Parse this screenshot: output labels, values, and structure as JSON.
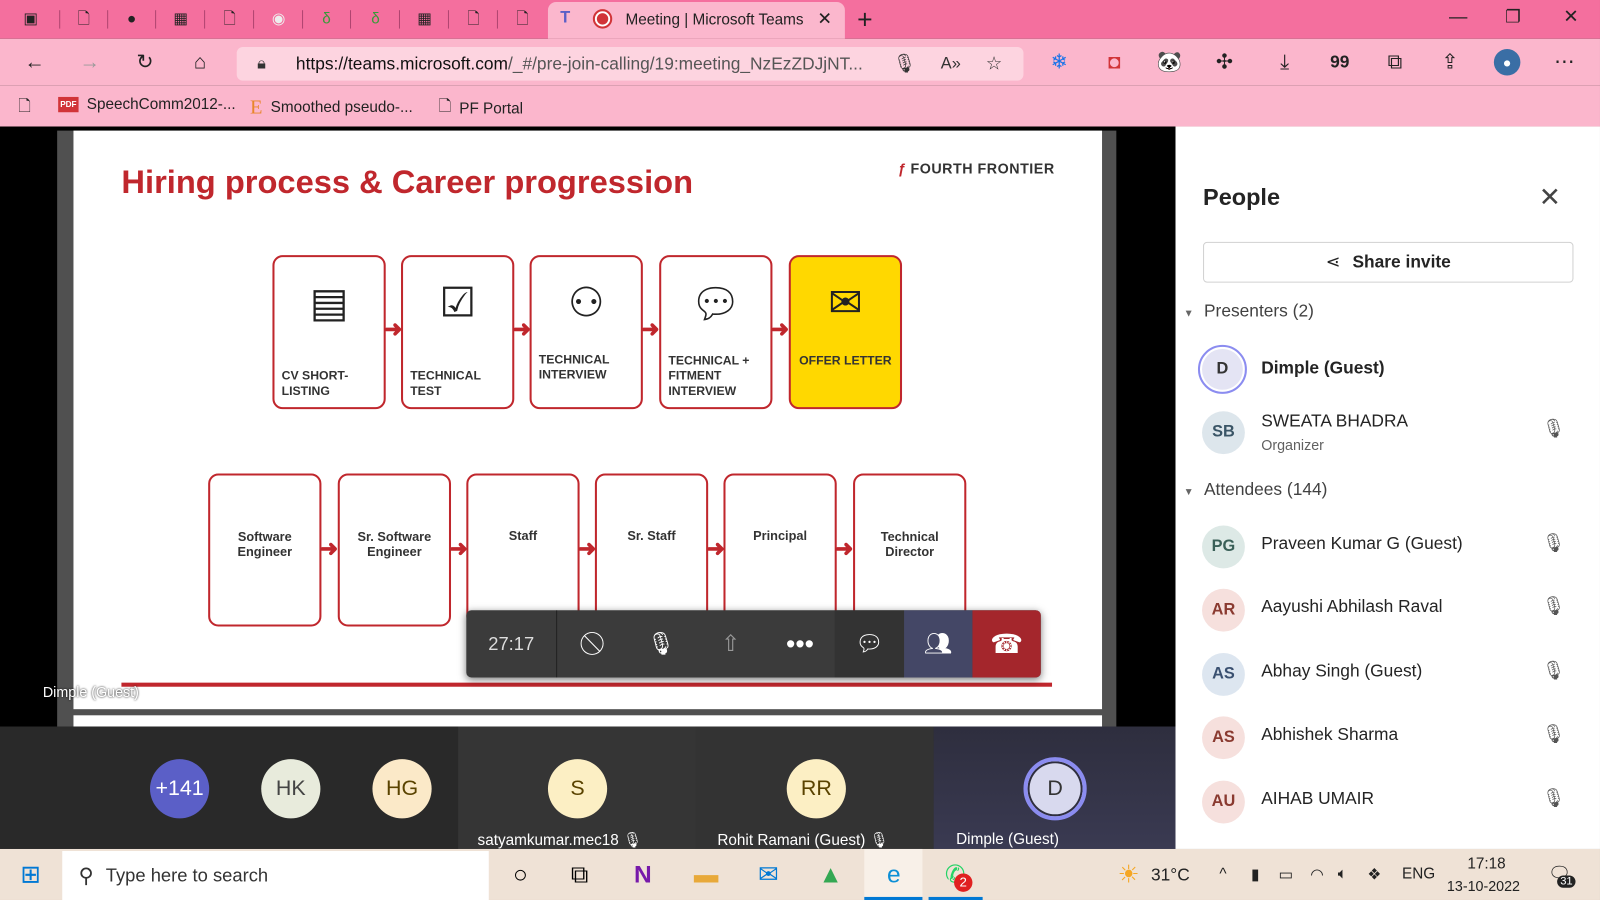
{
  "browser": {
    "active_tab_title": "Meeting | Microsoft Teams",
    "url_host": "https://teams.microsoft.com",
    "url_path": "/_#/pre-join-calling/19:meeting_NzEzZDJjNT...",
    "bookmarks": [
      {
        "label": "SpeechComm2012-...",
        "icon": "pdf-icon"
      },
      {
        "label": "Smoothed pseudo-...",
        "icon": "e-logo-icon"
      },
      {
        "label": "PF Portal",
        "icon": "page-icon"
      }
    ],
    "new_tab_label": "+",
    "extensions_badge": "99"
  },
  "slide": {
    "title": "Hiring process & Career progression",
    "logo": "FOURTH FRONTIER",
    "hiring_steps": [
      "CV SHORT-LISTING",
      "TECHNICAL TEST",
      "TECHNICAL INTERVIEW",
      "TECHNICAL + FITMENT INTERVIEW",
      "OFFER LETTER"
    ],
    "career_levels": [
      "Software Engineer",
      "Sr. Software Engineer",
      "Staff",
      "Sr. Staff",
      "Principal",
      "Technical Director"
    ],
    "presenter_label": "Dimple (Guest)",
    "accent": "#c0272d",
    "highlight": "#ffd800"
  },
  "call_toolbar": {
    "timer": "27:17",
    "end_color": "#a4262c"
  },
  "tiles": [
    {
      "initials": "+141",
      "color": "#5b5fc7",
      "name": ""
    },
    {
      "initials": "HK",
      "color": "#e8ebdc",
      "name": ""
    },
    {
      "initials": "HG",
      "color": "#fbe9c8",
      "name": ""
    },
    {
      "initials": "S",
      "color": "#fcefc4",
      "name": "satyamkumar.mec18"
    },
    {
      "initials": "RR",
      "color": "#fcefc4",
      "name": "Rohit Ramani (Guest)"
    },
    {
      "initials": "D",
      "color": "#d8d9ee",
      "name": "Dimple (Guest)"
    }
  ],
  "people": {
    "title": "People",
    "share_label": "Share invite",
    "presenters_label": "Presenters (2)",
    "attendees_label": "Attendees (144)",
    "presenters": [
      {
        "initials": "D",
        "name": "Dimple (Guest)",
        "sub": "",
        "color": "#e4e4f4"
      },
      {
        "initials": "SB",
        "name": "SWEATA BHADRA",
        "sub": "Organizer",
        "color": "#dde6ec"
      }
    ],
    "attendees": [
      {
        "initials": "PG",
        "name": "Praveen Kumar G (Guest)",
        "color": "#dde9e6"
      },
      {
        "initials": "AR",
        "name": "Aayushi Abhilash Raval",
        "color": "#f6e0dd"
      },
      {
        "initials": "AS",
        "name": "Abhay Singh (Guest)",
        "color": "#dde6f0"
      },
      {
        "initials": "AS",
        "name": "Abhishek Sharma",
        "color": "#f6e0dd"
      },
      {
        "initials": "AU",
        "name": "AIHAB UMAIR",
        "color": "#f6e0dd"
      }
    ]
  },
  "taskbar": {
    "search_placeholder": "Type here to search",
    "weather": "31°C",
    "language": "ENG",
    "time": "17:18",
    "date": "13-10-2022",
    "whatsapp_badge": "2",
    "notification_count": "31"
  }
}
